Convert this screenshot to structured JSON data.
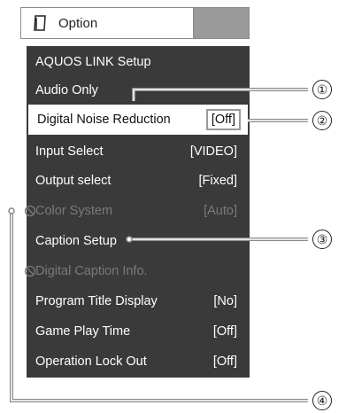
{
  "header": {
    "title": "Option",
    "icon": "book-icon"
  },
  "menu": {
    "items": [
      {
        "label": "AQUOS LINK Setup",
        "value": "",
        "state": "normal"
      },
      {
        "label": "Audio Only",
        "value": "",
        "state": "normal"
      },
      {
        "label": "Digital Noise Reduction",
        "value": "[Off]",
        "state": "selected"
      },
      {
        "label": "Input Select",
        "value": "[VIDEO]",
        "state": "normal"
      },
      {
        "label": "Output select",
        "value": "[Fixed]",
        "state": "normal"
      },
      {
        "label": "Color System",
        "value": "[Auto]",
        "state": "disabled"
      },
      {
        "label": "Caption Setup",
        "value": "",
        "state": "normal"
      },
      {
        "label": "Digital Caption Info.",
        "value": "",
        "state": "disabled"
      },
      {
        "label": "Program Title Display",
        "value": "[No]",
        "state": "normal"
      },
      {
        "label": "Game Play Time",
        "value": "[Off]",
        "state": "normal"
      },
      {
        "label": "Operation Lock Out",
        "value": "[Off]",
        "state": "normal"
      }
    ]
  },
  "callouts": {
    "c1": "①",
    "c2": "②",
    "c3": "③",
    "c4": "④"
  },
  "colors": {
    "menu_bg": "#3a3a3a",
    "disabled_text": "#7a7a7a",
    "highlight_bg": "#ffffff",
    "callout_line": "#8a8a8a"
  }
}
